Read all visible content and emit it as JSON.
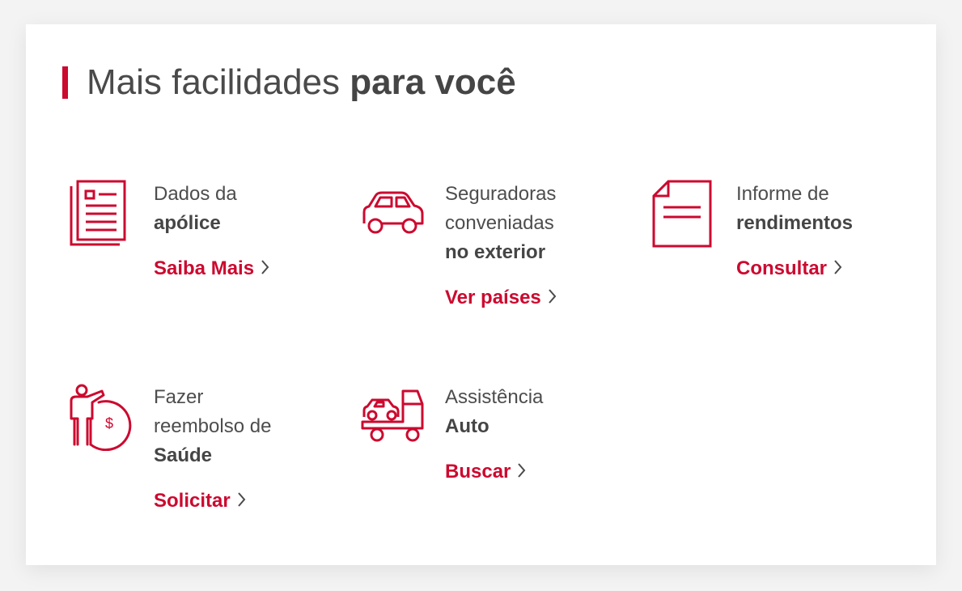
{
  "section": {
    "title_regular": "Mais facilidades",
    "title_bold": "para você"
  },
  "colors": {
    "accent": "#cc092f",
    "text": "#4a4a4a",
    "card": "#ffffff"
  },
  "items": [
    {
      "icon": "document-icon",
      "line1": "Dados da",
      "line2": "apólice",
      "line3": "",
      "link": "Saiba Mais"
    },
    {
      "icon": "car-icon",
      "line1": "Seguradoras",
      "line2": "conveniadas",
      "line3": "no exterior",
      "link": "Ver países"
    },
    {
      "icon": "file-icon",
      "line1": "Informe de",
      "line2": "rendimentos",
      "line3": "",
      "link": "Consultar"
    },
    {
      "icon": "refund-icon",
      "line1": "Fazer",
      "line2": "reembolso de",
      "line3": "Saúde",
      "link": "Solicitar"
    },
    {
      "icon": "tow-truck-icon",
      "line1": "Assistência",
      "line2": "Auto",
      "line3": "",
      "link": "Buscar"
    }
  ]
}
